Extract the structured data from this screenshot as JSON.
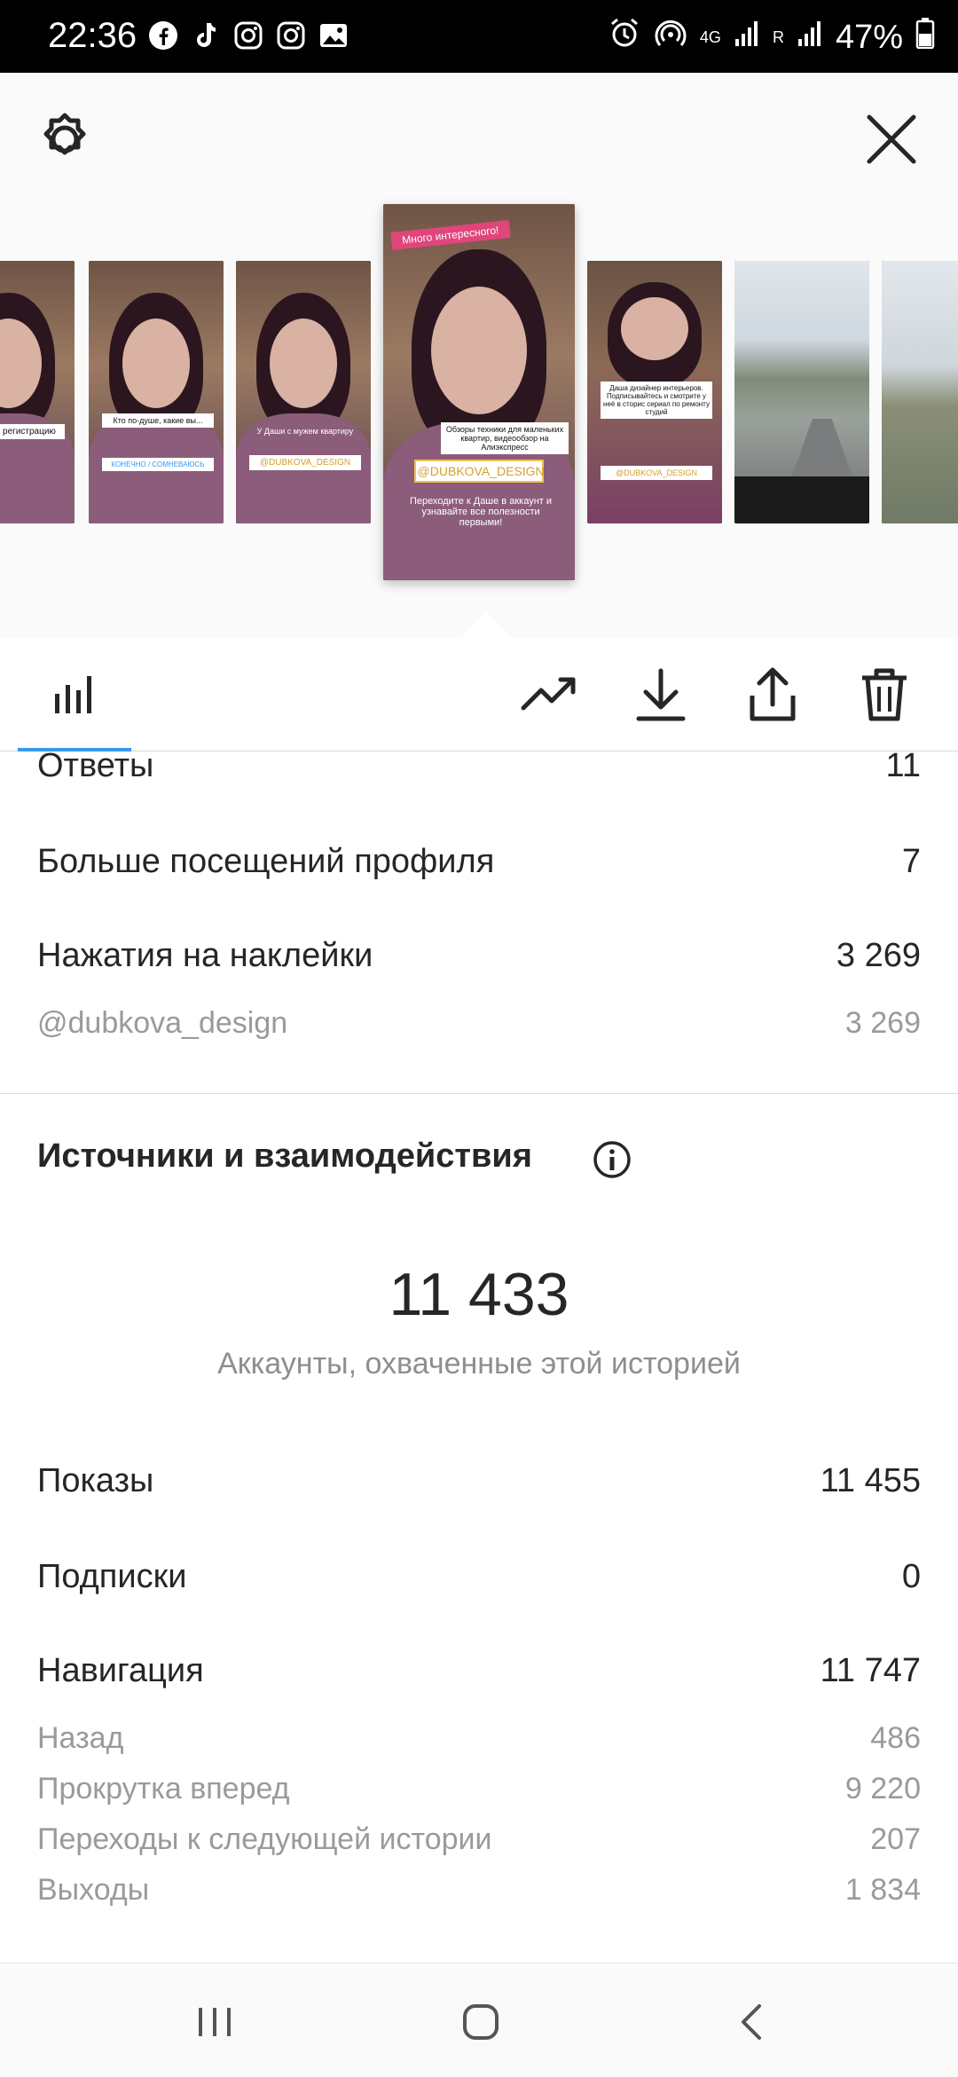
{
  "status_bar": {
    "time": "22:36",
    "app_icons": [
      "facebook-icon",
      "tiktok-icon",
      "instagram-icon",
      "instagram-icon",
      "gallery-icon"
    ],
    "network": "4G",
    "roaming": "R",
    "battery": "47%"
  },
  "stories": [
    {
      "caption": "...Теперь регистрацию",
      "sticker": "",
      "kind": "portrait"
    },
    {
      "caption": "Кто по-душе, какие вы...",
      "sticker": "КОНЕЧНО / СОМНЕВАЮСЬ",
      "kind": "portrait"
    },
    {
      "caption": "У Даши с мужем квартиру",
      "sticker": "@DUBKOVA_DESIGN",
      "kind": "portrait"
    },
    {
      "caption": "Обзоры техники для маленьких квартир, видеообзор на Алиэкспресс",
      "sticker": "@DUBKOVA_DESIGN",
      "banner": "Много интересного!",
      "footer": "Переходите к Даше в аккаунт и узнавайте все полезности первыми!",
      "kind": "portrait",
      "selected": true
    },
    {
      "caption": "Даша дизайнер интерьеров. Подписывайтесь и смотрите у неё в сторис сериал по ремонту студий",
      "sticker": "@DUBKOVA_DESIGN",
      "kind": "portrait"
    },
    {
      "caption": "",
      "sticker": "",
      "kind": "road"
    },
    {
      "caption": "",
      "sticker": "",
      "kind": "road"
    }
  ],
  "stats_top": [
    {
      "label": "Ответы",
      "value": "11",
      "style": "lg"
    },
    {
      "label": "Больше посещений профиля",
      "value": "7",
      "style": "lg"
    },
    {
      "label": "Нажатия на наклейки",
      "value": "3 269",
      "style": "lg"
    },
    {
      "label": "@dubkova_design",
      "value": "3 269",
      "style": "sm"
    }
  ],
  "section": {
    "title": "Источники и взаимодействия",
    "reach_value": "11 433",
    "reach_label": "Аккаунты, охваченные этой историей"
  },
  "stats_bottom": [
    {
      "label": "Показы",
      "value": "11 455",
      "style": "lg"
    },
    {
      "label": "Подписки",
      "value": "0",
      "style": "lg"
    },
    {
      "label": "Навигация",
      "value": "11 747",
      "style": "lg"
    },
    {
      "label": "Назад",
      "value": "486",
      "style": "sm"
    },
    {
      "label": "Прокрутка вперед",
      "value": "9 220",
      "style": "sm"
    },
    {
      "label": "Переходы к следующей истории",
      "value": "207",
      "style": "sm"
    },
    {
      "label": "Выходы",
      "value": "1 834",
      "style": "sm"
    }
  ],
  "colors": {
    "accent": "#3897f0",
    "muted": "#9a9a9a",
    "text": "#262626"
  }
}
